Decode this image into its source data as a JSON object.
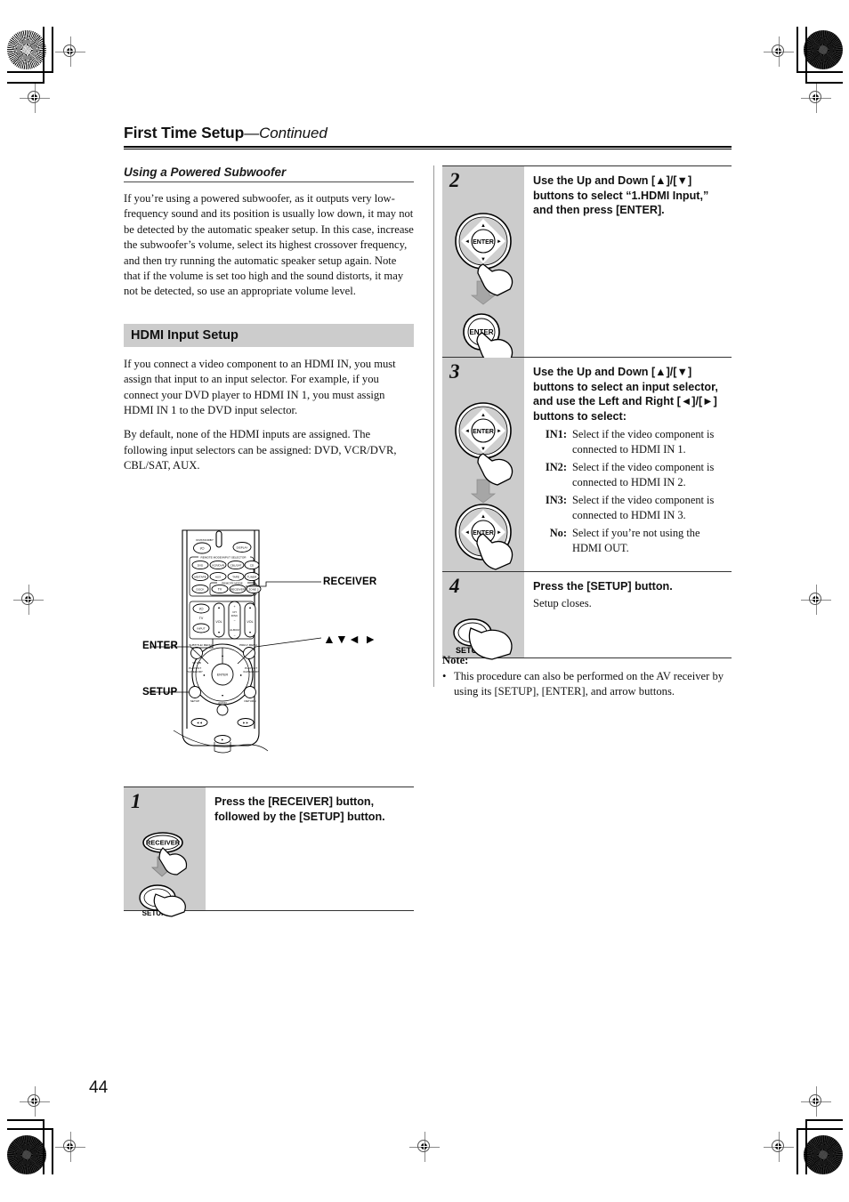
{
  "page": {
    "number": "44",
    "title_main": "First Time Setup",
    "title_cont": "—Continued"
  },
  "left_column": {
    "subwoofer_heading": "Using a Powered Subwoofer",
    "subwoofer_paragraph": "If you’re using a powered subwoofer, as it outputs very low-frequency sound and its position is usually low down, it may not be detected by the automatic speaker setup. In this case, increase the subwoofer’s volume, select its highest crossover frequency, and then try running the automatic speaker setup again. Note that if the volume is set too high and the sound distorts, it may not be detected, so use an appropriate volume level.",
    "hdmi_heading": "HDMI Input Setup",
    "hdmi_paragraph_1": "If you connect a video component to an HDMI IN, you must assign that input to an input selector. For example, if you connect your DVD player to HDMI IN 1, you must assign HDMI IN 1 to the DVD input selector.",
    "hdmi_paragraph_2": "By default, none of the HDMI inputs are assigned. The following input selectors can be assigned: DVD, VCR/DVR, CBL/SAT, AUX."
  },
  "remote": {
    "callouts": {
      "receiver": "RECEIVER",
      "enter": "ENTER",
      "setup": "SETUP",
      "arrows": "▲▼◄ ►"
    },
    "buttons": {
      "standby_label": "ON/STANDBY",
      "power": "I/⏻",
      "display": "DISPLAY",
      "group_label_1": "REMOTE MODE/INPUT SELECTOR",
      "group_label_2": "REMOTE MODE",
      "row1": [
        "DVD",
        "VCR/DVR",
        "CBL/SAT",
        "CD"
      ],
      "row2": [
        "MD/TAPE",
        "AUX",
        "TAPE",
        "TUNER"
      ],
      "row3": [
        "DOCK",
        "TV",
        "RECEIVER",
        "ZONE 2"
      ],
      "tv_power": "I/⏻",
      "tv_label": "TV",
      "tv_input": "INPUT",
      "vol_label": "VOL",
      "ch_disc_label": "CH\nDISC",
      "album_label": "ALBUM",
      "subtitle_menu": "SUBTITLE/ MENU",
      "prev_menu": "PREV./ MENU",
      "spa_b": "SP A/B",
      "playlist_left": "PLAYLIST /CATEGORY",
      "playlist_right": "PLAYLIST /CATEGORY",
      "enter": "ENTER",
      "setup": "SETUP",
      "audio": "AUDIO",
      "return": "RETURN"
    }
  },
  "steps": [
    {
      "number": "1",
      "bold_text": "Press the [RECEIVER] button, followed by the [SETUP] button.",
      "plain_text": "",
      "art": "receiver-then-setup",
      "art_labels": {
        "top": "RECEIVER",
        "bottom": "SETUP"
      }
    },
    {
      "number": "2",
      "bold_text": "Use the Up and Down [▲]/[▼] buttons to select “1.HDMI Input,” and then press [ENTER].",
      "plain_text": "",
      "art": "dpad-then-enter",
      "art_labels": {
        "top": "ENTER",
        "bottom": "ENTER"
      }
    },
    {
      "number": "3",
      "bold_text": "Use the Up and Down [▲]/[▼] buttons to select an input selector, and use the Left and Right [◄]/[►] buttons to select:",
      "plain_text": "",
      "art": "dpad-then-dpad",
      "art_labels": {
        "top": "ENTER",
        "bottom": "ENTER"
      },
      "options": [
        {
          "key": "IN1:",
          "value": "Select if the video component is connected to HDMI IN 1."
        },
        {
          "key": "IN2:",
          "value": "Select if the video component is connected to HDMI IN 2."
        },
        {
          "key": "IN3:",
          "value": "Select if the video component is connected to HDMI IN 3."
        },
        {
          "key": "No:",
          "value": "Select if you’re not using the HDMI OUT."
        }
      ]
    },
    {
      "number": "4",
      "bold_text": "Press the [SETUP] button.",
      "plain_text": "Setup closes.",
      "art": "setup-only",
      "art_labels": {
        "top": "",
        "bottom": "SETUP"
      }
    }
  ],
  "note": {
    "title": "Note:",
    "bullet": "•",
    "text": "This procedure can also be performed on the AV receiver by using its [SETUP], [ENTER], and arrow buttons."
  },
  "colors": {
    "gray_panel": "#cccccc",
    "rule": "#333333",
    "text": "#111111"
  }
}
